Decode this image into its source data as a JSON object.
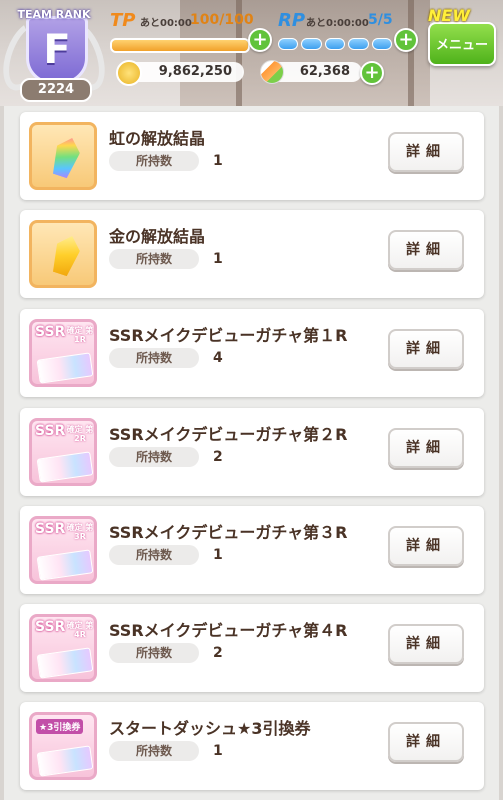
{
  "header": {
    "team_rank_label": "TEAM RANK",
    "rank_letter": "F",
    "rank_score": "2224",
    "tp": {
      "label": "TP",
      "timer": "あと00:00",
      "value": "100/100",
      "fill_fraction": 1.0
    },
    "rp": {
      "label": "RP",
      "timer": "あと0:00:00",
      "value": "5/5",
      "segments_filled": 5,
      "segments_total": 5
    },
    "new_badge": "NEW",
    "menu_label": "メニュー",
    "coins": "9,862,250",
    "carrots": "62,368"
  },
  "items": [
    {
      "name": "虹の解放結晶",
      "owned_label": "所持数",
      "count": "1",
      "icon": "rainbow-crystal-icon",
      "detail_label": "詳細"
    },
    {
      "name": "金の解放結晶",
      "owned_label": "所持数",
      "count": "1",
      "icon": "gold-crystal-icon",
      "detail_label": "詳細"
    },
    {
      "name": "SSRメイクデビューガチャ第１R",
      "owned_label": "所持数",
      "count": "4",
      "icon": "ssr-ticket-icon",
      "ticket_text": "SSR",
      "ticket_sub": "確定 第1R",
      "detail_label": "詳細"
    },
    {
      "name": "SSRメイクデビューガチャ第２R",
      "owned_label": "所持数",
      "count": "2",
      "icon": "ssr-ticket-icon",
      "ticket_text": "SSR",
      "ticket_sub": "確定 第2R",
      "detail_label": "詳細"
    },
    {
      "name": "SSRメイクデビューガチャ第３R",
      "owned_label": "所持数",
      "count": "1",
      "icon": "ssr-ticket-icon",
      "ticket_text": "SSR",
      "ticket_sub": "確定 第3R",
      "detail_label": "詳細"
    },
    {
      "name": "SSRメイクデビューガチャ第４R",
      "owned_label": "所持数",
      "count": "2",
      "icon": "ssr-ticket-icon",
      "ticket_text": "SSR",
      "ticket_sub": "確定 第4R",
      "detail_label": "詳細"
    },
    {
      "name": "スタートダッシュ★3引換券",
      "owned_label": "所持数",
      "count": "1",
      "icon": "star3-exchange-ticket-icon",
      "ticket_text": "★3引換券",
      "detail_label": "詳細"
    }
  ],
  "colors": {
    "accent_green": "#61c33a",
    "tp_orange": "#f1a12a",
    "rp_blue": "#3ea0ef",
    "rank_purple": "#7d6ad4",
    "text_brown": "#4a3326"
  }
}
